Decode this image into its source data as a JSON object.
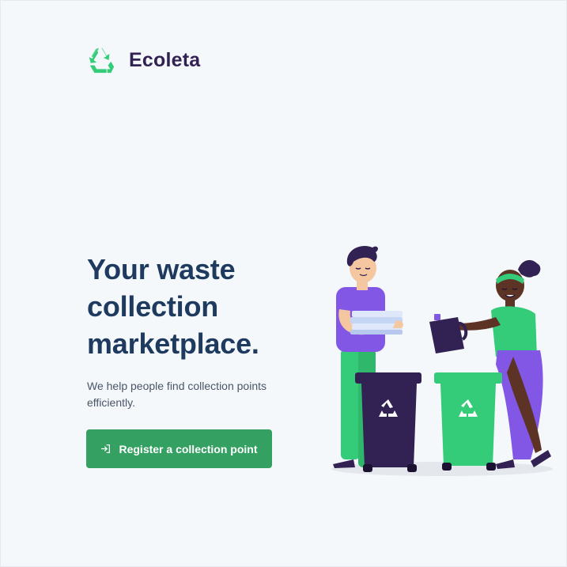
{
  "header": {
    "brand_name": "Ecoleta",
    "logo_icon": "recycle-icon"
  },
  "hero": {
    "title_lines": [
      "Your waste",
      "collection",
      "marketplace."
    ],
    "description": "We help people find collection points efficiently.",
    "cta_label": "Register a collection point",
    "cta_icon": "sign-in-icon"
  },
  "colors": {
    "brand_green": "#34cb79",
    "button_green": "#34a061",
    "dark_purple": "#322153",
    "title_navy": "#1e3a5f",
    "background": "#f5f8fb"
  }
}
